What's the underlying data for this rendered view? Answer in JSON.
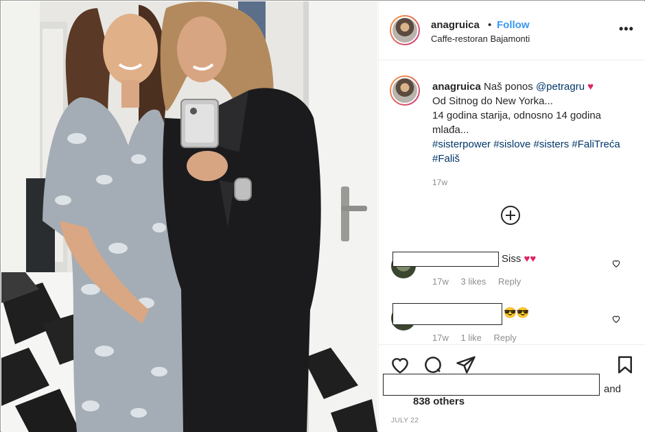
{
  "post": {
    "username": "anagruica",
    "separator": "•",
    "follow_label": "Follow",
    "location": "Caffe-restoran Bajamonti",
    "more_label": "•••"
  },
  "caption": {
    "username": "anagruica",
    "line1": "Naš ponos ",
    "mention": "@petragru",
    "heart": "♥",
    "line2": "Od Sitnog do New Yorka...",
    "line3": "14 godina starija, odnosno 14 godina mlađa...",
    "hashtags": "#sisterpower #sislove #sisters #FaliTreća #Fališ",
    "age": "17w"
  },
  "comments": [
    {
      "text_suffix": "Siss",
      "emoji": "♥♥",
      "age": "17w",
      "likes": "3 likes",
      "reply": "Reply"
    },
    {
      "text_suffix": "",
      "emoji": "😎😎",
      "age": "17w",
      "likes": "1 like",
      "reply": "Reply"
    }
  ],
  "likes": {
    "and_text": "and",
    "others_text": "838 others"
  },
  "date": "JULY 22",
  "colors": {
    "accent": "#3897f0",
    "heart": "#e0245e",
    "hashtag": "#003569",
    "muted": "#8e8e8e"
  },
  "icons": [
    "heart-icon",
    "comment-icon",
    "share-icon",
    "bookmark-icon",
    "add-circle-icon"
  ]
}
